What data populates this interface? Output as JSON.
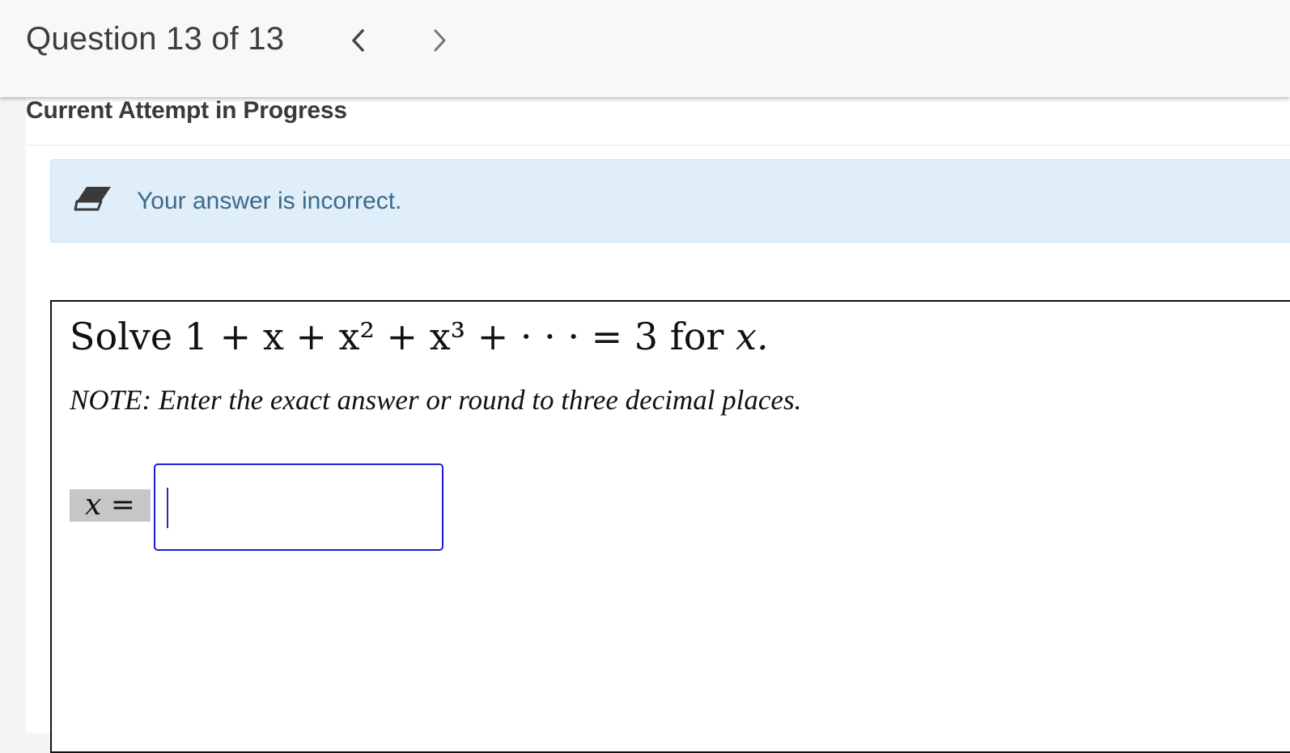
{
  "header": {
    "question_counter": "Question 13 of 13",
    "prev_icon": "chevron-left-icon",
    "next_icon": "chevron-right-icon"
  },
  "attempt": {
    "title": "Current Attempt in Progress"
  },
  "feedback": {
    "icon": "eraser-icon",
    "message": "Your answer is incorrect.",
    "colors": {
      "background": "#dfeef8",
      "text": "#3a6a8c"
    }
  },
  "question": {
    "solve_word": "Solve",
    "series": "1 + x + x² + x³ + · · · = 3",
    "for_word": "for",
    "variable": "x.",
    "note": "NOTE: Enter the exact answer or round to three decimal places.",
    "answer_label": "x =",
    "answer_value": ""
  },
  "colors": {
    "input_border": "#1a1ad4"
  }
}
